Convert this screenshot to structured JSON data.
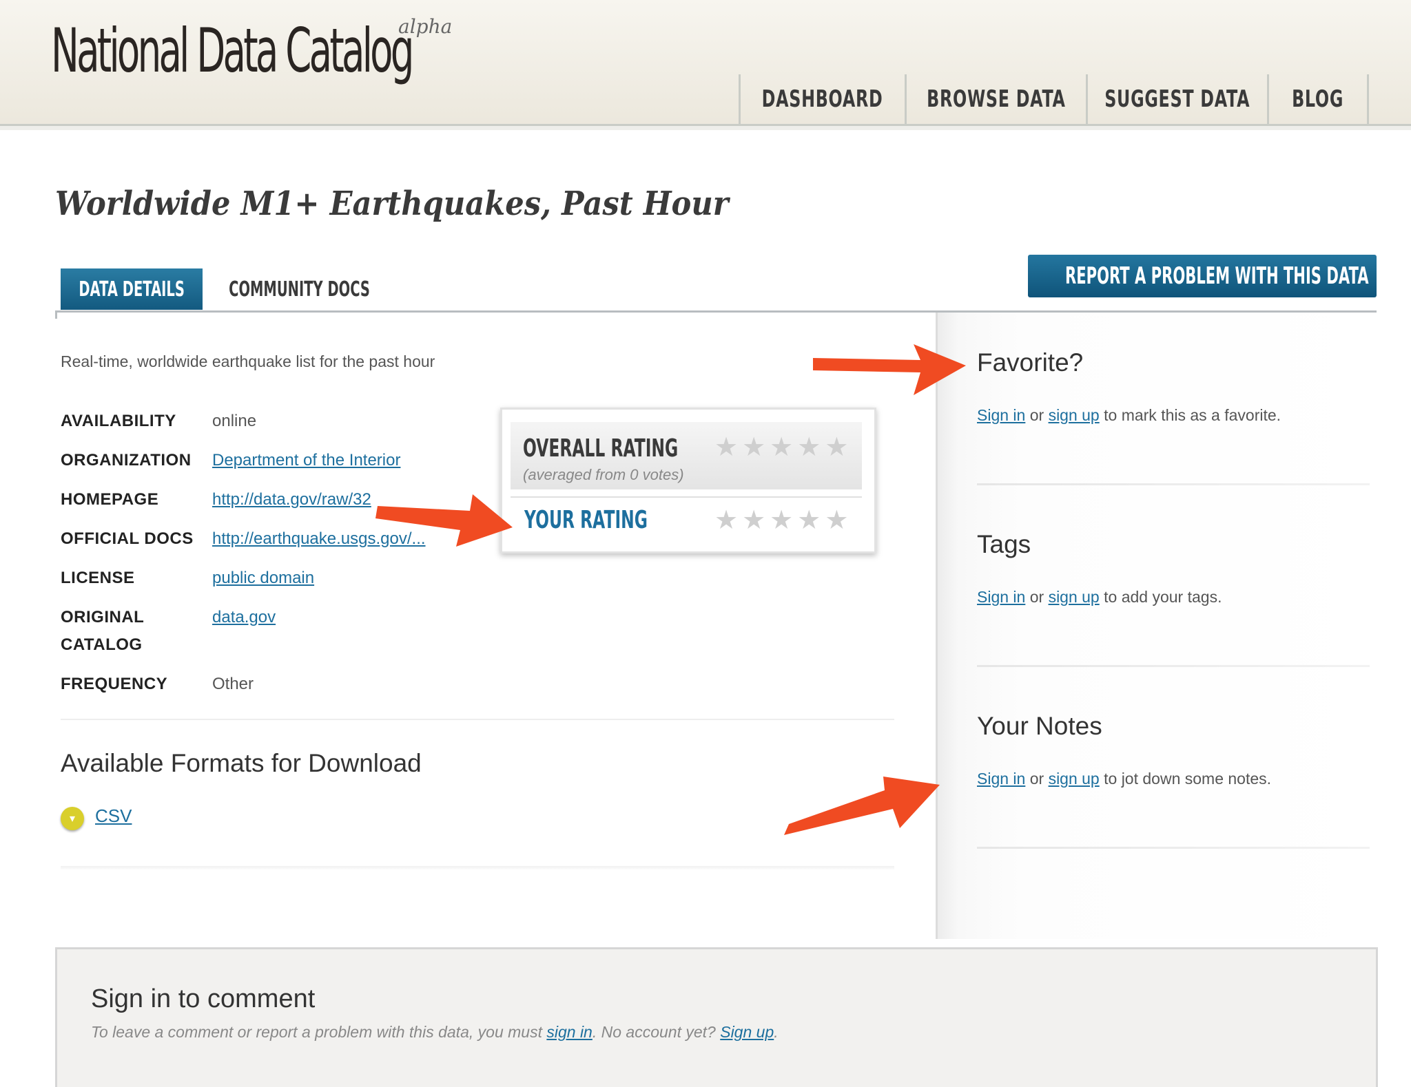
{
  "header": {
    "logo": "National Data Catalog",
    "logo_badge": "alpha",
    "nav": [
      "DASHBOARD",
      "BROWSE DATA",
      "SUGGEST DATA",
      "BLOG"
    ]
  },
  "page": {
    "title": "Worldwide M1+ Earthquakes, Past Hour",
    "tabs": {
      "active": "DATA DETAILS",
      "inactive": "COMMUNITY DOCS"
    },
    "report_button": "REPORT A PROBLEM WITH THIS DATA",
    "description": "Real-time, worldwide earthquake list for the past hour",
    "details": {
      "availability_label": "AVAILABILITY",
      "availability": "online",
      "organization_label": "ORGANIZATION",
      "organization": "Department of the Interior",
      "homepage_label": "HOMEPAGE",
      "homepage": "http://data.gov/raw/32",
      "official_docs_label": "OFFICIAL DOCS",
      "official_docs": "http://earthquake.usgs.gov/...",
      "license_label": "LICENSE",
      "license": "public domain",
      "original_catalog_label_1": "ORIGINAL",
      "original_catalog_label_2": "CATALOG",
      "original_catalog": "data.gov",
      "frequency_label": "FREQUENCY",
      "frequency": "Other"
    },
    "rating": {
      "overall_label": "OVERALL RATING",
      "overall_sub": "(averaged from 0 votes)",
      "overall_stars": 0,
      "your_label": "YOUR RATING",
      "your_stars": 0
    },
    "formats": {
      "title": "Available Formats for Download",
      "items": [
        "CSV"
      ]
    }
  },
  "sidebar": {
    "favorite": {
      "title": "Favorite?",
      "sign_in": "Sign in",
      "or": "or",
      "sign_up": "sign up",
      "rest": "to mark this as a favorite."
    },
    "tags": {
      "title": "Tags",
      "sign_in": "Sign in",
      "or": "or",
      "sign_up": "sign up",
      "rest": "to add your tags."
    },
    "notes": {
      "title": "Your Notes",
      "sign_in": "Sign in",
      "or": "or",
      "sign_up": "sign up",
      "rest": "to jot down some notes."
    }
  },
  "comment": {
    "title": "Sign in to comment",
    "text_1": "To leave a comment or report a problem with this data, you must",
    "sign_in": "sign in",
    "text_2": ". No account yet?",
    "sign_up": "Sign up",
    "text_3": "."
  },
  "colors": {
    "accent": "#1d6f9e",
    "arrow": "#f04b22",
    "csv_icon": "#d9cf2c"
  },
  "icons": {
    "report": "flag-icon",
    "csv": "chevron-down-icon",
    "star": "star-icon"
  }
}
